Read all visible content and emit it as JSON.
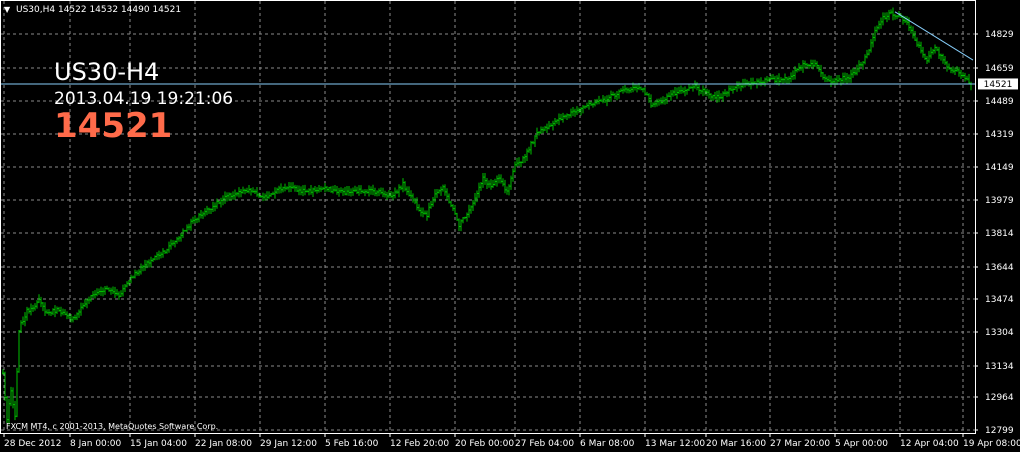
{
  "header": {
    "symbol_line": "US30,H4  14522 14532 14490 14521"
  },
  "overlay": {
    "symbol": "US30-H4",
    "datetime": "2013.04.19 19:21:06",
    "price": "14521"
  },
  "copyright": "FXCM MT4, c 2001-2013, MetaQuotes Software Corp.",
  "colors": {
    "background": "#000000",
    "bars": "#00c000",
    "grid": "#8a8a8a",
    "axis_text": "#ffffff",
    "price_overlay": "#ff6b4a",
    "price_line": "#87cefa",
    "trend_line": "#87cefa"
  },
  "chart_data": {
    "type": "ohlc",
    "y_ticks": [
      "14829",
      "14659",
      "14489",
      "14319",
      "14149",
      "13979",
      "13814",
      "13644",
      "13474",
      "13304",
      "13134",
      "12964",
      "12799"
    ],
    "x_ticks": [
      "28 Dec 2012",
      "8 Jan 00:00",
      "15 Jan 04:00",
      "22 Jan 08:00",
      "29 Jan 12:00",
      "5 Feb 16:00",
      "12 Feb 20:00",
      "20 Feb 00:00",
      "27 Feb 04:00",
      "6 Mar 08:00",
      "13 Mar 12:00",
      "20 Mar 16:00",
      "27 Mar 20:00",
      "5 Apr 00:00",
      "12 Apr 04:00",
      "19 Apr 08:00"
    ],
    "ylim": [
      12799,
      14904
    ],
    "current_price": 14521,
    "current_price_label": "14521",
    "last_bar": {
      "open": 14522,
      "high": 14532,
      "low": 14490,
      "close": 14521
    },
    "anchors": [
      [
        0,
        13080
      ],
      [
        2,
        12850
      ],
      [
        4,
        12990
      ],
      [
        6,
        12860
      ],
      [
        8,
        13300
      ],
      [
        12,
        13390
      ],
      [
        18,
        13440
      ],
      [
        22,
        13380
      ],
      [
        28,
        13400
      ],
      [
        34,
        13340
      ],
      [
        40,
        13420
      ],
      [
        46,
        13480
      ],
      [
        52,
        13500
      ],
      [
        58,
        13470
      ],
      [
        64,
        13560
      ],
      [
        70,
        13610
      ],
      [
        76,
        13660
      ],
      [
        82,
        13700
      ],
      [
        88,
        13760
      ],
      [
        94,
        13830
      ],
      [
        100,
        13880
      ],
      [
        106,
        13920
      ],
      [
        112,
        13960
      ],
      [
        118,
        13980
      ],
      [
        124,
        13990
      ],
      [
        130,
        13950
      ],
      [
        136,
        13990
      ],
      [
        142,
        14010
      ],
      [
        148,
        13990
      ],
      [
        154,
        13990
      ],
      [
        160,
        14000
      ],
      [
        166,
        13990
      ],
      [
        172,
        13980
      ],
      [
        178,
        13990
      ],
      [
        184,
        13990
      ],
      [
        190,
        13980
      ],
      [
        194,
        13960
      ],
      [
        200,
        14020
      ],
      [
        204,
        13960
      ],
      [
        208,
        13900
      ],
      [
        212,
        13870
      ],
      [
        216,
        13980
      ],
      [
        220,
        14000
      ],
      [
        224,
        13920
      ],
      [
        228,
        13820
      ],
      [
        232,
        13880
      ],
      [
        236,
        13950
      ],
      [
        240,
        14050
      ],
      [
        244,
        14010
      ],
      [
        248,
        14050
      ],
      [
        252,
        13980
      ],
      [
        256,
        14110
      ],
      [
        260,
        14150
      ],
      [
        264,
        14220
      ],
      [
        268,
        14290
      ],
      [
        272,
        14310
      ],
      [
        278,
        14340
      ],
      [
        284,
        14380
      ],
      [
        290,
        14410
      ],
      [
        296,
        14420
      ],
      [
        302,
        14450
      ],
      [
        308,
        14480
      ],
      [
        314,
        14500
      ],
      [
        320,
        14500
      ],
      [
        324,
        14420
      ],
      [
        328,
        14430
      ],
      [
        334,
        14470
      ],
      [
        340,
        14480
      ],
      [
        346,
        14510
      ],
      [
        352,
        14470
      ],
      [
        358,
        14450
      ],
      [
        364,
        14500
      ],
      [
        370,
        14520
      ],
      [
        376,
        14530
      ],
      [
        382,
        14540
      ],
      [
        388,
        14540
      ],
      [
        394,
        14560
      ],
      [
        400,
        14620
      ],
      [
        406,
        14620
      ],
      [
        410,
        14560
      ],
      [
        414,
        14540
      ],
      [
        420,
        14550
      ],
      [
        424,
        14560
      ],
      [
        428,
        14610
      ],
      [
        432,
        14660
      ],
      [
        436,
        14780
      ],
      [
        440,
        14850
      ],
      [
        444,
        14870
      ],
      [
        448,
        14860
      ],
      [
        452,
        14820
      ],
      [
        456,
        14740
      ],
      [
        460,
        14670
      ],
      [
        462,
        14640
      ],
      [
        466,
        14700
      ],
      [
        470,
        14640
      ],
      [
        474,
        14590
      ],
      [
        478,
        14580
      ],
      [
        482,
        14550
      ],
      [
        484,
        14521
      ]
    ],
    "trend_line": [
      [
        446,
        14880
      ],
      [
        485,
        14640
      ]
    ]
  }
}
